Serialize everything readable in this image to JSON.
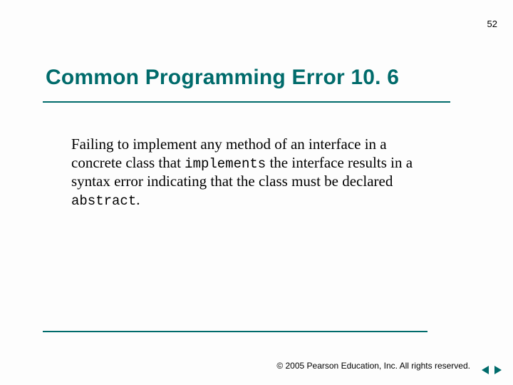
{
  "page_number": "52",
  "heading": "Common Programming Error 10. 6",
  "body": {
    "seg1": "Failing to implement any method of an interface in a concrete class that ",
    "code1": "implements",
    "seg2": " the interface results in a syntax error indicating that the class must be declared ",
    "code2": "abstract",
    "seg3": "."
  },
  "footer": "© 2005 Pearson Education, Inc.  All rights reserved.",
  "nav": {
    "prev_icon": "triangle-left",
    "next_icon": "triangle-right"
  },
  "colors": {
    "accent": "#006b6b"
  }
}
